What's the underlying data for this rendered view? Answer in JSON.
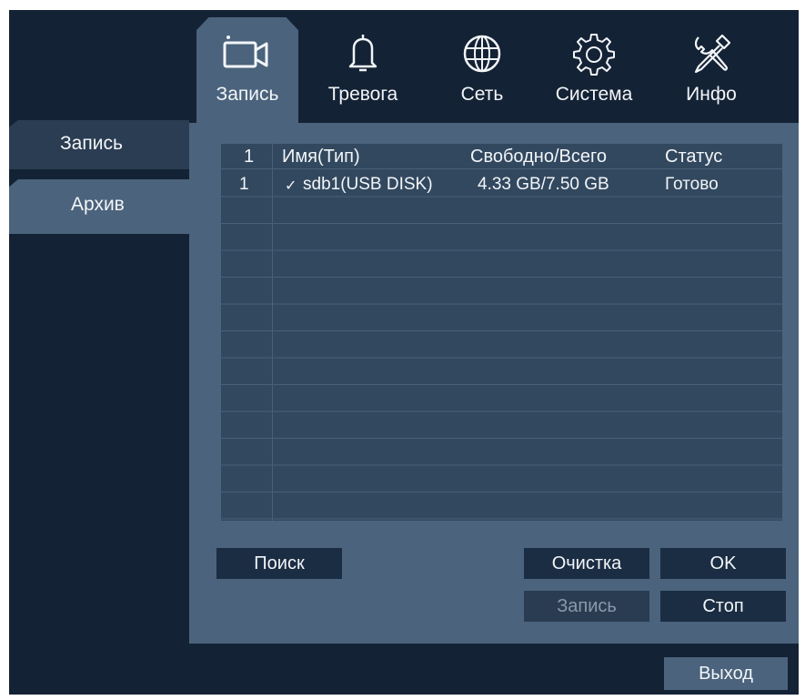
{
  "top_tabs": [
    {
      "label": "Запись",
      "icon": "video-camera-icon",
      "active": true
    },
    {
      "label": "Тревога",
      "icon": "bell-icon",
      "active": false
    },
    {
      "label": "Сеть",
      "icon": "globe-icon",
      "active": false
    },
    {
      "label": "Система",
      "icon": "gear-icon",
      "active": false
    },
    {
      "label": "Инфо",
      "icon": "tools-icon",
      "active": false
    }
  ],
  "side_tabs": [
    {
      "label": "Запись",
      "active": false
    },
    {
      "label": "Архив",
      "active": true
    }
  ],
  "disk_table": {
    "headers": [
      "1",
      "Имя(Тип)",
      "Свободно/Всего",
      "Статус"
    ],
    "rows": [
      {
        "num": "1",
        "check": "✓",
        "name": "sdb1(USB DISK)",
        "space": "4.33 GB/7.50 GB",
        "status": "Готово"
      }
    ]
  },
  "buttons": {
    "search": "Поиск",
    "clear": "Очистка",
    "ok": "OK",
    "record": "Запись",
    "stop": "Стоп",
    "exit": "Выход"
  },
  "colors": {
    "background": "#142235",
    "panel": "#4b637c",
    "table": "#32485f",
    "button": "#1b2d43",
    "text": "#f2f5f8"
  }
}
